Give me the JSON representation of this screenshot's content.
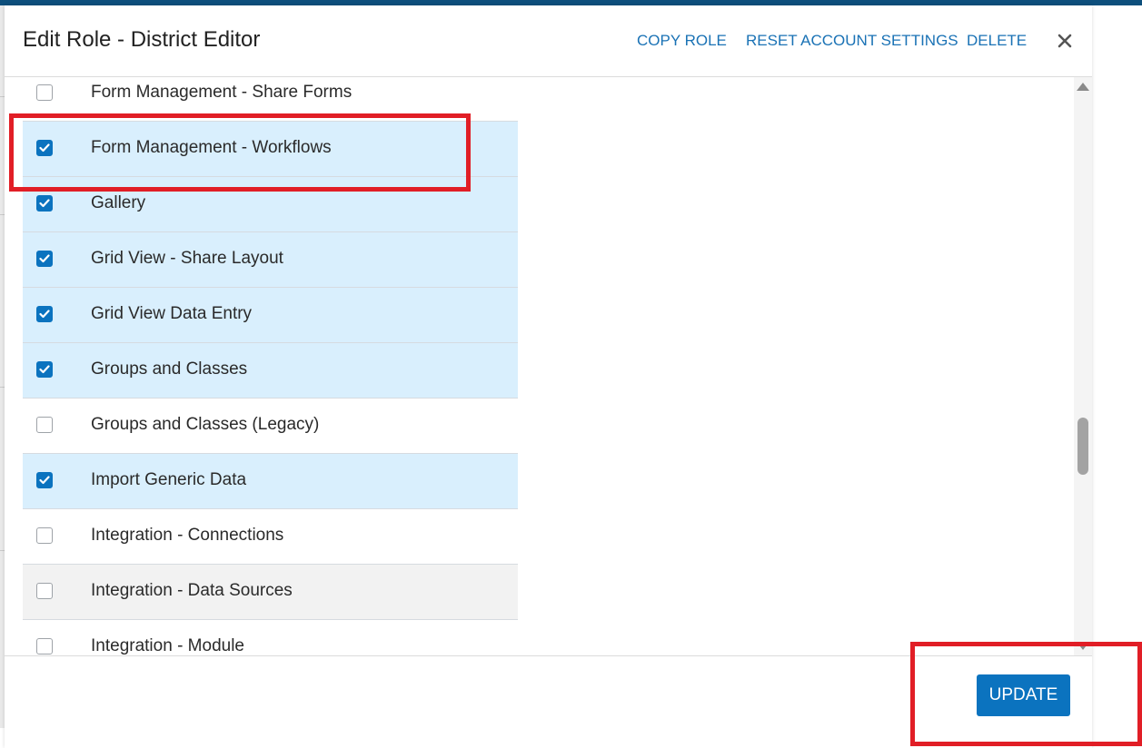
{
  "modal": {
    "title": "Edit Role - District Editor",
    "actions": {
      "copy_role": "COPY ROLE",
      "reset_account_settings": "RESET ACCOUNT SETTINGS",
      "delete": "DELETE"
    },
    "close_icon": "close-icon"
  },
  "permissions": [
    {
      "label": "Form Management - Share Forms",
      "checked": false
    },
    {
      "label": "Form Management - Workflows",
      "checked": true
    },
    {
      "label": "Gallery",
      "checked": true
    },
    {
      "label": "Grid View - Share Layout",
      "checked": true
    },
    {
      "label": "Grid View Data Entry",
      "checked": true
    },
    {
      "label": "Groups and Classes",
      "checked": true
    },
    {
      "label": "Groups and Classes (Legacy)",
      "checked": false
    },
    {
      "label": "Import Generic Data",
      "checked": true
    },
    {
      "label": "Integration - Connections",
      "checked": false
    },
    {
      "label": "Integration - Data Sources",
      "checked": false,
      "hovered": true
    },
    {
      "label": "Integration - Module",
      "checked": false
    }
  ],
  "footer": {
    "update_label": "UPDATE"
  },
  "colors": {
    "accent": "#0b73bf",
    "checked_row": "#d9effd",
    "highlight": "#e11e26"
  }
}
